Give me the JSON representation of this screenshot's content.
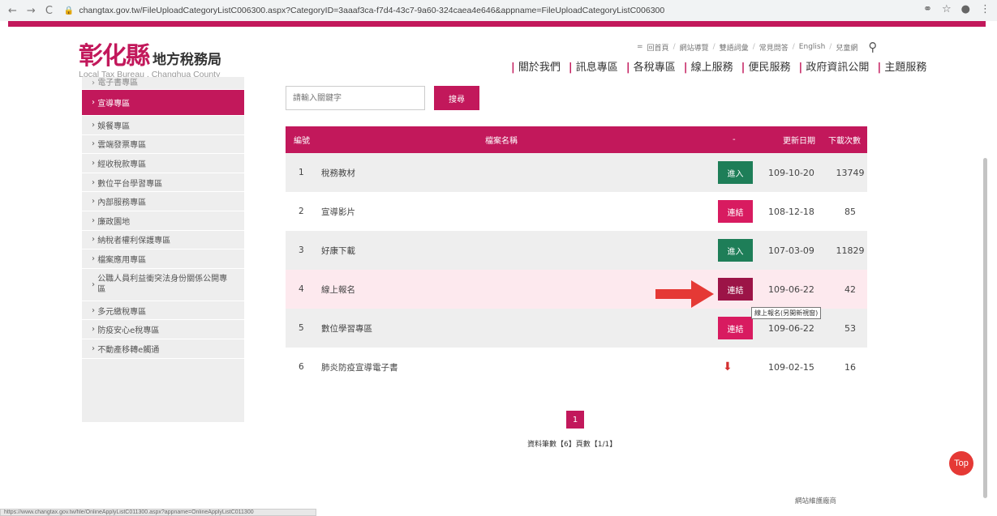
{
  "browser": {
    "url": "changtax.gov.tw/FileUploadCategoryListC006300.aspx?CategoryID=3aaaf3ca-f7d4-43c7-9a60-324caea4e646&appname=FileUploadCategoryListC006300",
    "status_url": "https://www.changtax.gov.tw/file/OnlineApplyListC011300.aspx?appname=OnlineApplyListC011300"
  },
  "header": {
    "logo_mark": "彰化縣",
    "logo_title": "地方稅務局",
    "logo_en": "Local Tax Bureau , Changhua County",
    "util_links": [
      "回首頁",
      "網站導覽",
      "雙語詞彙",
      "常見問答",
      "English",
      "兒童網"
    ],
    "main_nav": [
      "關於我們",
      "訊息專區",
      "各稅專區",
      "線上服務",
      "便民服務",
      "政府資訊公開",
      "主題服務"
    ]
  },
  "sidebar": {
    "items": [
      {
        "label": "電子書專區"
      },
      {
        "label": "宣導專區"
      },
      {
        "label": "娛餐專區"
      },
      {
        "label": "雲端發票專區"
      },
      {
        "label": "經收稅款專區"
      },
      {
        "label": "數位平台學習專區"
      },
      {
        "label": "內部服務專區"
      },
      {
        "label": "廉政園地"
      },
      {
        "label": "納稅者權利保護專區"
      },
      {
        "label": "檔案應用專區"
      },
      {
        "label": "公職人員利益衝突法身份關係公開專區"
      },
      {
        "label": "多元繳稅專區"
      },
      {
        "label": "防疫安心e稅專區"
      },
      {
        "label": "不動產移轉e觸通"
      }
    ]
  },
  "search": {
    "placeholder": "請輸入關鍵字",
    "button": "搜尋"
  },
  "table": {
    "headers": {
      "num": "編號",
      "name": "檔案名稱",
      "action": "-",
      "date": "更新日期",
      "downloads": "下載次數"
    },
    "rows": [
      {
        "num": "1",
        "name": "稅務教材",
        "action": "進入",
        "date": "109-10-20",
        "downloads": "13749"
      },
      {
        "num": "2",
        "name": "宣導影片",
        "action": "連結",
        "date": "108-12-18",
        "downloads": "85"
      },
      {
        "num": "3",
        "name": "好康下載",
        "action": "進入",
        "date": "107-03-09",
        "downloads": "11829"
      },
      {
        "num": "4",
        "name": "線上報名",
        "action": "連結",
        "date": "109-06-22",
        "downloads": "42"
      },
      {
        "num": "5",
        "name": "數位學習專區",
        "action": "連結",
        "date": "109-06-22",
        "downloads": "53"
      },
      {
        "num": "6",
        "name": "肺炎防疫宣導電子書",
        "action": "",
        "date": "109-02-15",
        "downloads": "16"
      }
    ],
    "tooltip": "線上報名(另開新視窗)"
  },
  "pagination": {
    "current": "1",
    "info": "資料筆數【6】頁數【1/1】"
  },
  "top_button": "Top",
  "footer": {
    "link": "網站維護廠商"
  },
  "colors": {
    "brand": "#c2185b",
    "green": "#1e7e58",
    "arrow": "#e53935"
  }
}
